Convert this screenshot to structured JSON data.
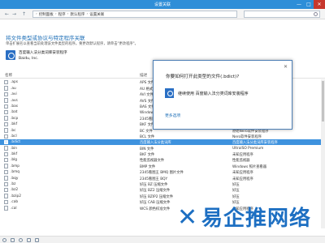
{
  "window": {
    "title": "设置关联",
    "min_glyph": "—",
    "max_glyph": "□",
    "close_glyph": "✕"
  },
  "address": {
    "back_glyph": "←",
    "forward_glyph": "→",
    "up_glyph": "↑",
    "path": [
      "控制面板",
      "程序",
      "默认程序",
      "设置关联"
    ],
    "sep": "›"
  },
  "header": {
    "title": "将文件类型或协议与特定程序关联",
    "subtitle": "单击扩展名以查看当前处理该文件类型的程序。要更改默认程序，请单击\"更改程序\"。"
  },
  "current_app": {
    "name": "百度输入法分类词库安装程序",
    "company": "Baidu, Inc."
  },
  "columns": {
    "name": "名称",
    "description": "描述",
    "current_default": "当前默认值"
  },
  "rows": [
    {
      "ext": ".aps",
      "desc": "APS 文件",
      "prog": ""
    },
    {
      "ext": ".au",
      "desc": "AU 格式声音",
      "prog": ""
    },
    {
      "ext": ".avi",
      "desc": "AVI 文件",
      "prog": ""
    },
    {
      "ext": ".avs",
      "desc": "AVS 文件",
      "prog": ""
    },
    {
      "ext": ".bas",
      "desc": "BAS 文件",
      "prog": ""
    },
    {
      "ext": ".bat",
      "desc": "Windows 批处理文件",
      "prog": ""
    },
    {
      "ext": ".bcp",
      "desc": "2345看图王 BCP",
      "prog": ""
    },
    {
      "ext": ".bkf",
      "desc": "BKF 文件",
      "prog": ""
    },
    {
      "ext": ".bc",
      "desc": "BC 文件",
      "prog": "原始Nero软件安装程序"
    },
    {
      "ext": ".bcl",
      "desc": "BCL 文件",
      "prog": "Nero软件安装程序"
    },
    {
      "ext": ".bdict",
      "desc": "百度输入法分类词库",
      "prog": "百度输入法分类词库安装程序"
    },
    {
      "ext": ".bin",
      "desc": "BIN 文件",
      "prog": "UltraISO Premium"
    },
    {
      "ext": ".bkf",
      "desc": "BKF 文件",
      "prog": "未知应用程序"
    },
    {
      "ext": ".blg",
      "desc": "性能监视器文件",
      "prog": "性能监视器"
    },
    {
      "ext": ".bmp",
      "desc": "BMP 文件",
      "prog": "Windows 照片查看器"
    },
    {
      "ext": ".bmq",
      "desc": "2345看图王 BMQ 图片文件",
      "prog": "未知应用程序"
    },
    {
      "ext": ".bqy",
      "desc": "2345看图王 BQY",
      "prog": "未知应用程序"
    },
    {
      "ext": ".bz",
      "desc": "好压 BZ 压缩文件",
      "prog": "好压"
    },
    {
      "ext": ".bz2",
      "desc": "好压 BZ2 压缩文件",
      "prog": "好压"
    },
    {
      "ext": ".bzip2",
      "desc": "好压 BZIP2 压缩文件",
      "prog": "好压"
    },
    {
      "ext": ".cab",
      "desc": "好压 CAB 压缩文件",
      "prog": "好压"
    },
    {
      "ext": ".cal",
      "desc": "WCS 颜色校准文件",
      "prog": "未知应用程序"
    }
  ],
  "popup": {
    "title": "你要如何打开此类型的文件(.bdict)?",
    "close_glyph": "✕",
    "option": "继续使用 百度输入法分类词库安装程序",
    "more": "更多选项"
  },
  "watermark": {
    "logo": "✕",
    "text": "易企推网络"
  },
  "colors": {
    "accent": "#2e8ed8",
    "selection": "#3e92de",
    "link": "#1e6fb7",
    "brand": "#1d6fc2"
  }
}
